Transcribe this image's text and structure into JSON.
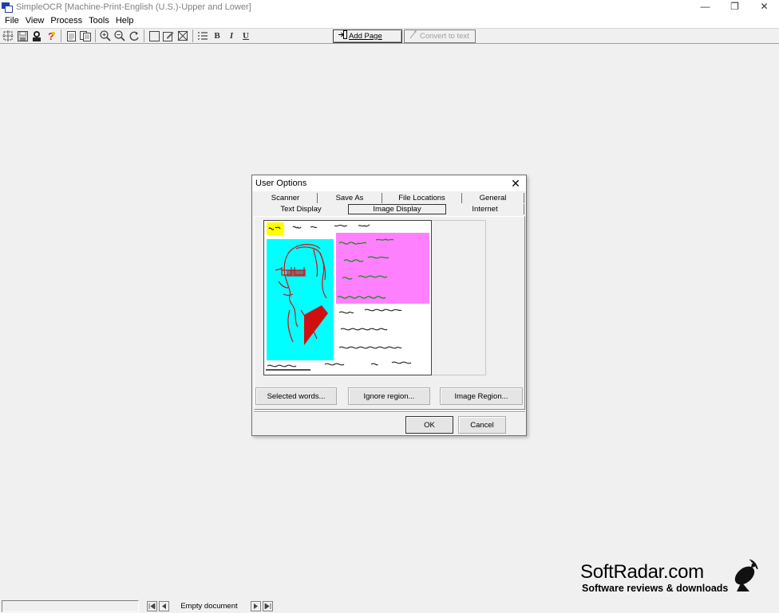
{
  "window": {
    "title": "SimpleOCR [Machine-Print-English (U.S.)-Upper and Lower]",
    "minimize": "—",
    "restore": "❐",
    "close": "✕"
  },
  "menu": [
    "File",
    "View",
    "Process",
    "Tools",
    "Help"
  ],
  "toolbar": {
    "bold": "B",
    "italic": "I",
    "underline": "U",
    "add_page": "Add Page",
    "convert": "Convert to text"
  },
  "dialog": {
    "title": "User Options",
    "close": "✕",
    "tabs_row1": [
      "Scanner",
      "Save As",
      "File Locations",
      "General"
    ],
    "tabs_row2": [
      "Text Display",
      "Image Display",
      "Internet"
    ],
    "active_tab": "Image Display",
    "buttons": {
      "selected_words": "Selected words...",
      "ignore_region": "Ignore region...",
      "image_region": "Image Region...",
      "ok": "OK",
      "cancel": "Cancel"
    },
    "preview_lines": [
      "it is, as far as we",
      "know, the",
      "only way",
      "of coming",
      "downstairs,",
      "but sometimes",
      "we feel that",
      "there really is",
      "another way, it only"
    ],
    "colors": {
      "selected_words": "#ffff00",
      "ignore_region": "#ff80ff",
      "image_region": "#00ffff",
      "ink": "#1a8c1a"
    }
  },
  "status": {
    "document": "Empty document"
  },
  "watermark": {
    "brand": "SoftRadar.com",
    "tagline": "Software reviews & downloads"
  }
}
